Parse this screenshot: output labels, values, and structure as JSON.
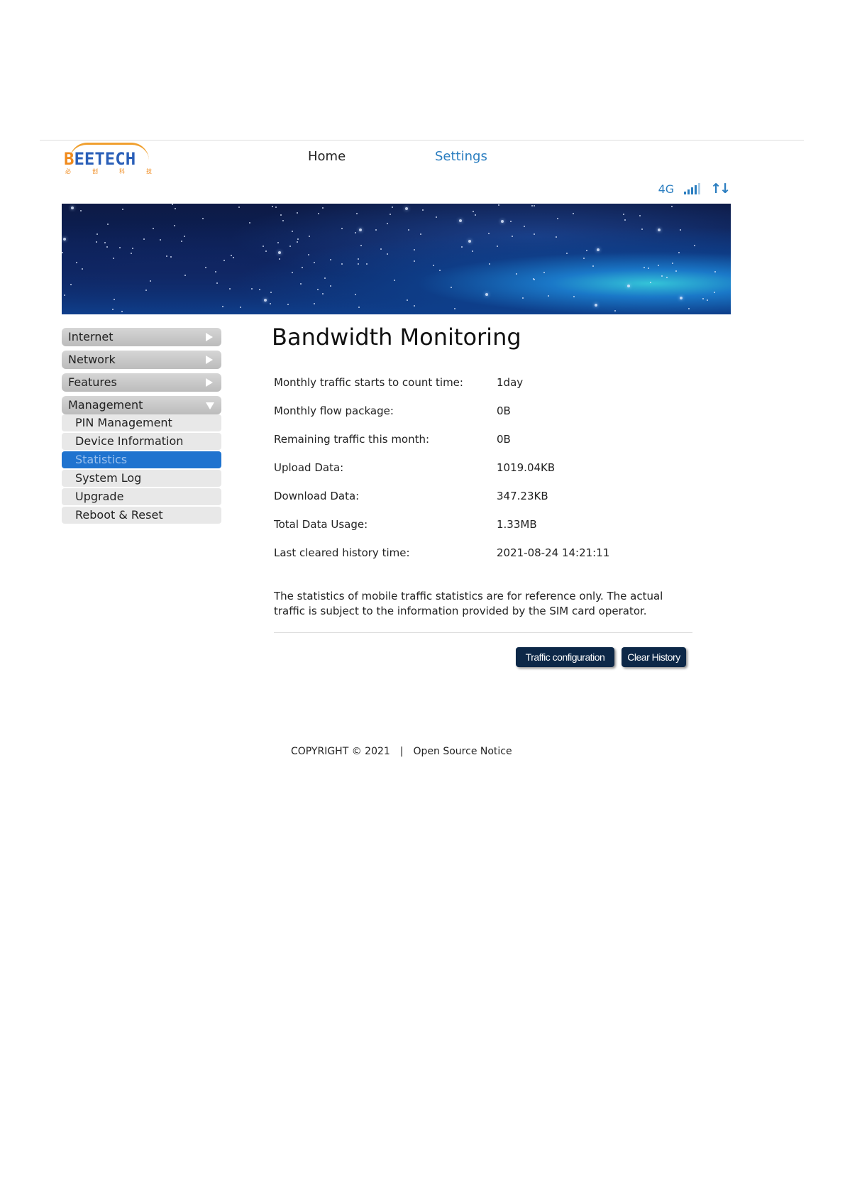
{
  "brand": {
    "logo_text": "BEETECH",
    "logo_subtext": [
      "必",
      "创",
      "科",
      "技"
    ]
  },
  "nav": {
    "home": "Home",
    "settings": "Settings"
  },
  "status": {
    "network": "4G",
    "signal_bars": 4,
    "icons": [
      "signal-icon",
      "data-transfer-icon"
    ],
    "accent_color": "#2b7ec0"
  },
  "sidebar": {
    "menus": [
      {
        "label": "Internet",
        "expanded": false
      },
      {
        "label": "Network",
        "expanded": false
      },
      {
        "label": "Features",
        "expanded": false
      },
      {
        "label": "Management",
        "expanded": true
      }
    ],
    "submenu": [
      {
        "label": "PIN Management"
      },
      {
        "label": "Device Information"
      },
      {
        "label": "Statistics",
        "active": true
      },
      {
        "label": "System Log"
      },
      {
        "label": "Upgrade"
      },
      {
        "label": "Reboot & Reset"
      }
    ],
    "active_color": "#1f73cf"
  },
  "page_title": "Bandwidth Monitoring",
  "stats": [
    {
      "label": "Monthly traffic starts to count time:",
      "value": "1day"
    },
    {
      "label": "Monthly flow package:",
      "value": "0B"
    },
    {
      "label": "Remaining traffic this month:",
      "value": "0B"
    },
    {
      "label": "Upload Data:",
      "value": "1019.04KB"
    },
    {
      "label": "Download Data:",
      "value": "347.23KB"
    },
    {
      "label": "Total Data Usage:",
      "value": "1.33MB"
    },
    {
      "label": "Last cleared history time:",
      "value": "2021-08-24 14:21:11"
    }
  ],
  "note": "The statistics of mobile traffic statistics are for reference only. The actual traffic is subject to the information provided by the SIM card operator.",
  "buttons": {
    "traffic_config": "Traffic configuration",
    "clear_history": "Clear History"
  },
  "footer": {
    "copyright": "COPYRIGHT © 2021",
    "separator": "|",
    "notice": "Open Source Notice"
  }
}
